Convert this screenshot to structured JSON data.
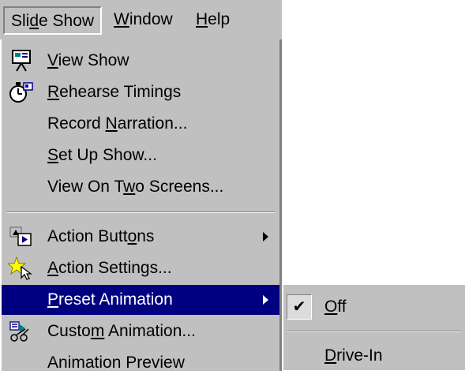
{
  "menubar": {
    "slide_show": {
      "pre": "Sli",
      "acc": "d",
      "post": "e Show"
    },
    "window": {
      "pre": "",
      "acc": "W",
      "post": "indow"
    },
    "help": {
      "pre": "",
      "acc": "H",
      "post": "elp"
    }
  },
  "menu": {
    "items": [
      {
        "icon": "projector-screen-icon",
        "pre": "",
        "acc": "V",
        "post": "iew Show"
      },
      {
        "icon": "stopwatch-icon",
        "pre": "",
        "acc": "R",
        "post": "ehearse Timings"
      },
      {
        "icon": "",
        "pre": "Record ",
        "acc": "N",
        "post": "arration..."
      },
      {
        "icon": "",
        "pre": "",
        "acc": "S",
        "post": "et Up Show..."
      },
      {
        "icon": "",
        "pre": "View On T",
        "acc": "w",
        "post": "o Screens..."
      },
      {
        "icon": "action-buttons-icon",
        "pre": "Action Butt",
        "acc": "o",
        "post": "ns"
      },
      {
        "icon": "action-settings-icon",
        "pre": "",
        "acc": "A",
        "post": "ction Settings..."
      },
      {
        "icon": "",
        "pre": "",
        "acc": "P",
        "post": "reset Animation"
      },
      {
        "icon": "custom-animation-icon",
        "pre": "Custo",
        "acc": "m",
        "post": " Animation..."
      },
      {
        "icon": "",
        "pre": "Animation Preview",
        "acc": "",
        "post": ""
      }
    ]
  },
  "submenu": {
    "items": [
      {
        "checked": true,
        "check_glyph": "✔",
        "pre": "",
        "acc": "O",
        "post": "ff"
      },
      {
        "checked": false,
        "pre": "",
        "acc": "D",
        "post": "rive-In"
      }
    ]
  },
  "colors": {
    "menu_bg": "#c0c0c0",
    "highlight": "#000080",
    "highlight_text": "#ffffff"
  }
}
